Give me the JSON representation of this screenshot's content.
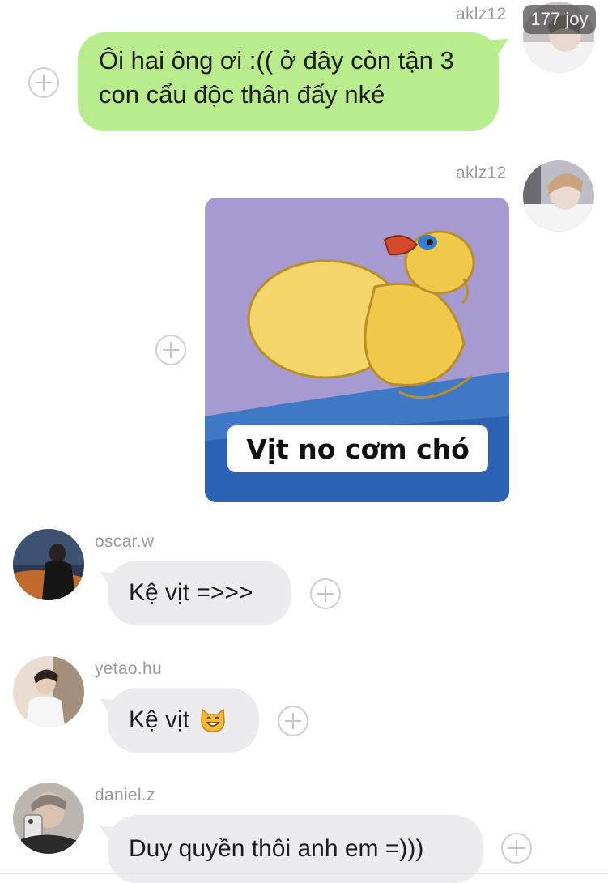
{
  "messages": [
    {
      "direction": "outgoing",
      "sender": "aklz12",
      "avatar_badge": "177 joy",
      "text_lines": [
        "Ôi hai ông ơi :(( ở đây còn tận 3",
        "con cẩu độc thân đấy nké"
      ]
    },
    {
      "direction": "outgoing",
      "sender": "aklz12",
      "type": "sticker",
      "sticker_caption": "Vịt no cơm chó"
    },
    {
      "direction": "incoming",
      "sender": "oscar.w",
      "text": "Kệ vịt =>>>"
    },
    {
      "direction": "incoming",
      "sender": "yetao.hu",
      "text": "Kệ vịt",
      "emoji": "grinning-cat-icon"
    },
    {
      "direction": "incoming",
      "sender": "daniel.z",
      "text": "Duy quyền thôi anh em =)))"
    }
  ],
  "colors": {
    "outgoing_bubble": "#b9ec8c",
    "incoming_bubble": "#ececee",
    "sender_name": "#9a9a9a",
    "background": "#ffffff"
  }
}
